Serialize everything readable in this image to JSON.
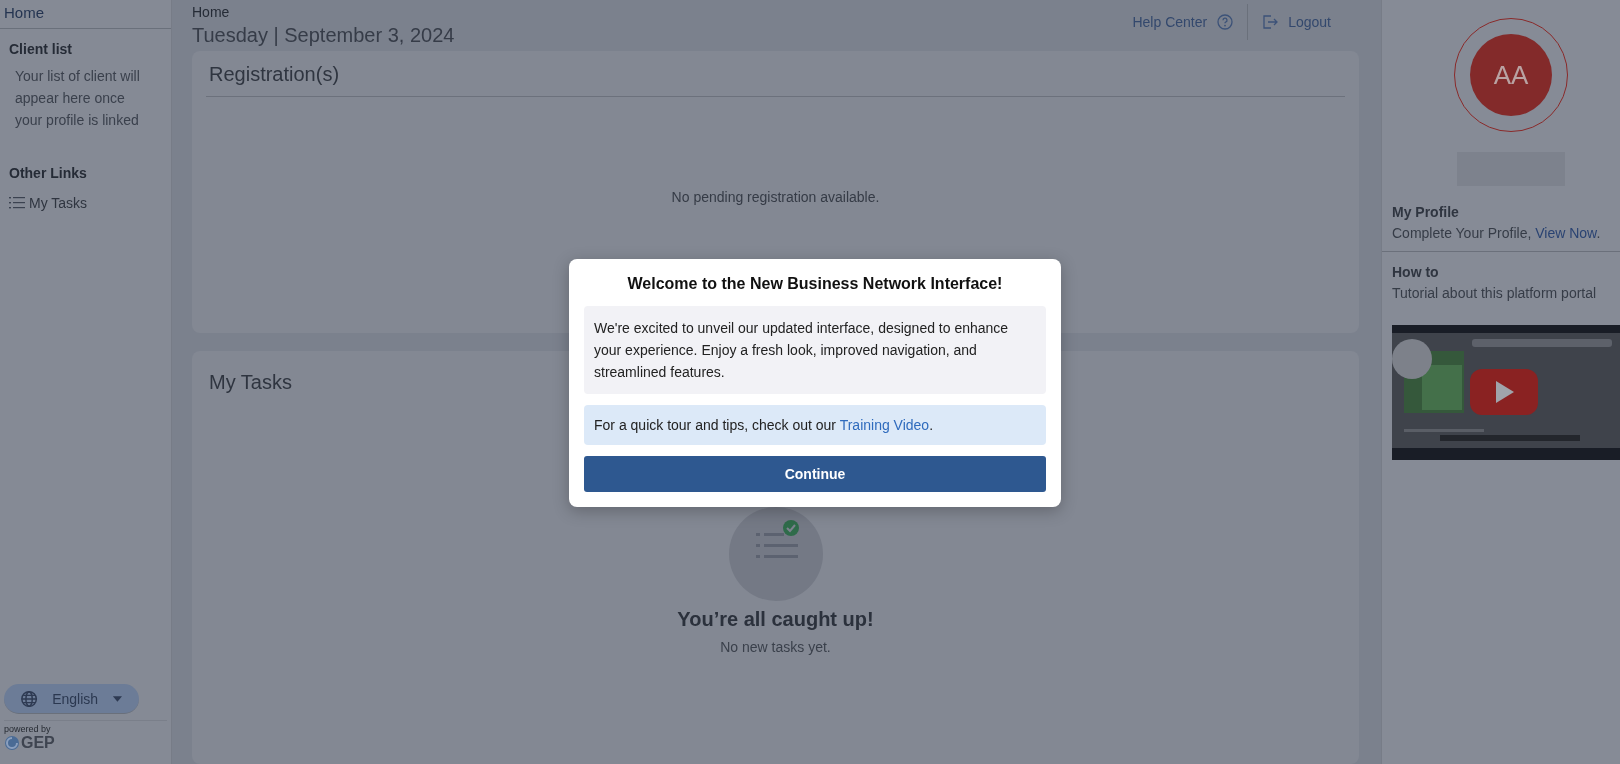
{
  "sidebar": {
    "home": "Home",
    "client_list": {
      "title": "Client list",
      "text": "Your list of client will appear here once your profile is linked"
    },
    "other_links": {
      "title": "Other Links",
      "items": [
        {
          "label": "My Tasks"
        }
      ]
    },
    "language": "English",
    "powered_by": "powered by",
    "brand": "GEP"
  },
  "header": {
    "breadcrumb": "Home",
    "date": "Tuesday | September 3, 2024",
    "help": "Help Center",
    "logout": "Logout"
  },
  "registrations": {
    "title": "Registration(s)",
    "empty": "No pending registration available."
  },
  "tasks": {
    "title": "My Tasks",
    "empty_title": "You’re all caught up!",
    "empty_text": "No new tasks yet."
  },
  "profile": {
    "initials": "AA",
    "title": "My Profile",
    "text": "Complete Your Profile, ",
    "link": "View Now",
    "end": "."
  },
  "how_to": {
    "title": "How to",
    "text": "Tutorial about this platform portal"
  },
  "modal": {
    "title": "Welcome to the New Business Network Interface!",
    "body": "We're excited to unveil our updated interface, designed to enhance your experience. Enjoy a fresh look, improved navigation, and streamlined features.",
    "tip": "For a quick tour and tips, check out our ",
    "tip_link": "Training Video",
    "tip_end": ".",
    "button": "Continue"
  }
}
